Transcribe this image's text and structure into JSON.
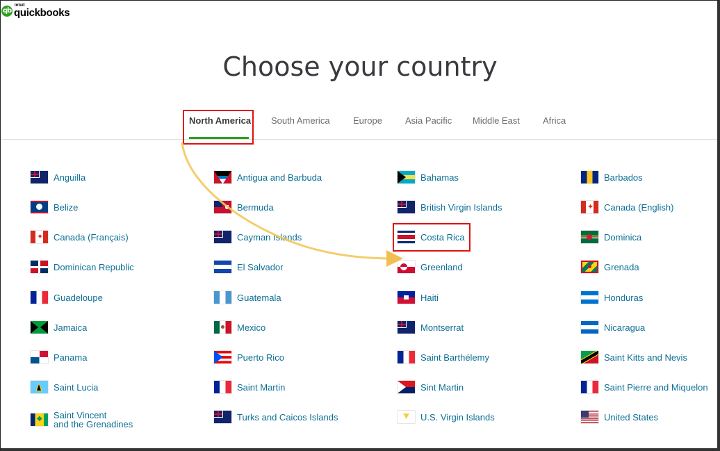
{
  "logo": {
    "small": "intuit",
    "name": "quickbooks",
    "mark": "qb"
  },
  "title": "Choose your country",
  "tabs": [
    {
      "label": "North America",
      "active": true
    },
    {
      "label": "South America",
      "active": false
    },
    {
      "label": "Europe",
      "active": false
    },
    {
      "label": "Asia Pacific",
      "active": false
    },
    {
      "label": "Middle East",
      "active": false
    },
    {
      "label": "Africa",
      "active": false
    }
  ],
  "colors": {
    "accent": "#2ca01c",
    "link": "#0d6f94",
    "highlight": "#e01010",
    "arrow": "#f0c040"
  },
  "countries": [
    {
      "name": "Anguilla",
      "flag": "uk-ensign"
    },
    {
      "name": "Antigua and Barbuda",
      "flag": "antigua"
    },
    {
      "name": "Bahamas",
      "flag": "bahamas"
    },
    {
      "name": "Barbados",
      "flag": "barbados"
    },
    {
      "name": "Belize",
      "flag": "belize"
    },
    {
      "name": "Bermuda",
      "flag": "bermuda"
    },
    {
      "name": "British Virgin Islands",
      "flag": "uk-ensign"
    },
    {
      "name": "Canada (English)",
      "flag": "canada"
    },
    {
      "name": "Canada (Français)",
      "flag": "canada"
    },
    {
      "name": "Cayman Islands",
      "flag": "uk-ensign"
    },
    {
      "name": "Costa Rica",
      "flag": "costa-rica",
      "highlighted": true
    },
    {
      "name": "Dominica",
      "flag": "dominica"
    },
    {
      "name": "Dominican Republic",
      "flag": "dominican-republic"
    },
    {
      "name": "El Salvador",
      "flag": "el-salvador"
    },
    {
      "name": "Greenland",
      "flag": "greenland"
    },
    {
      "name": "Grenada",
      "flag": "grenada"
    },
    {
      "name": "Guadeloupe",
      "flag": "france"
    },
    {
      "name": "Guatemala",
      "flag": "guatemala"
    },
    {
      "name": "Haiti",
      "flag": "haiti"
    },
    {
      "name": "Honduras",
      "flag": "honduras"
    },
    {
      "name": "Jamaica",
      "flag": "jamaica"
    },
    {
      "name": "Mexico",
      "flag": "mexico"
    },
    {
      "name": "Montserrat",
      "flag": "uk-ensign"
    },
    {
      "name": "Nicaragua",
      "flag": "nicaragua"
    },
    {
      "name": "Panama",
      "flag": "panama"
    },
    {
      "name": "Puerto Rico",
      "flag": "puerto-rico"
    },
    {
      "name": "Saint Barthélemy",
      "flag": "france"
    },
    {
      "name": "Saint Kitts and Nevis",
      "flag": "saint-kitts"
    },
    {
      "name": "Saint Lucia",
      "flag": "saint-lucia"
    },
    {
      "name": "Saint Martin",
      "flag": "france"
    },
    {
      "name": "Sint Martin",
      "flag": "sint-maarten"
    },
    {
      "name": "Saint Pierre and Miquelon",
      "flag": "france"
    },
    {
      "name": "Saint Vincent\nand the Grenadines",
      "flag": "saint-vincent"
    },
    {
      "name": "Turks and Caicos Islands",
      "flag": "uk-ensign"
    },
    {
      "name": "U.S. Virgin Islands",
      "flag": "usvi"
    },
    {
      "name": "United States",
      "flag": "usa"
    }
  ]
}
